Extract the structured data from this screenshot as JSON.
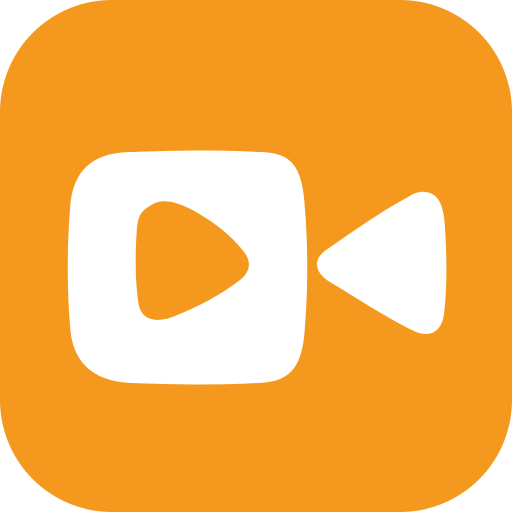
{
  "app_icon": {
    "icon": "video-camera-icon",
    "colors": {
      "background": "#F4991D",
      "foreground": "#FFFFFF"
    }
  }
}
